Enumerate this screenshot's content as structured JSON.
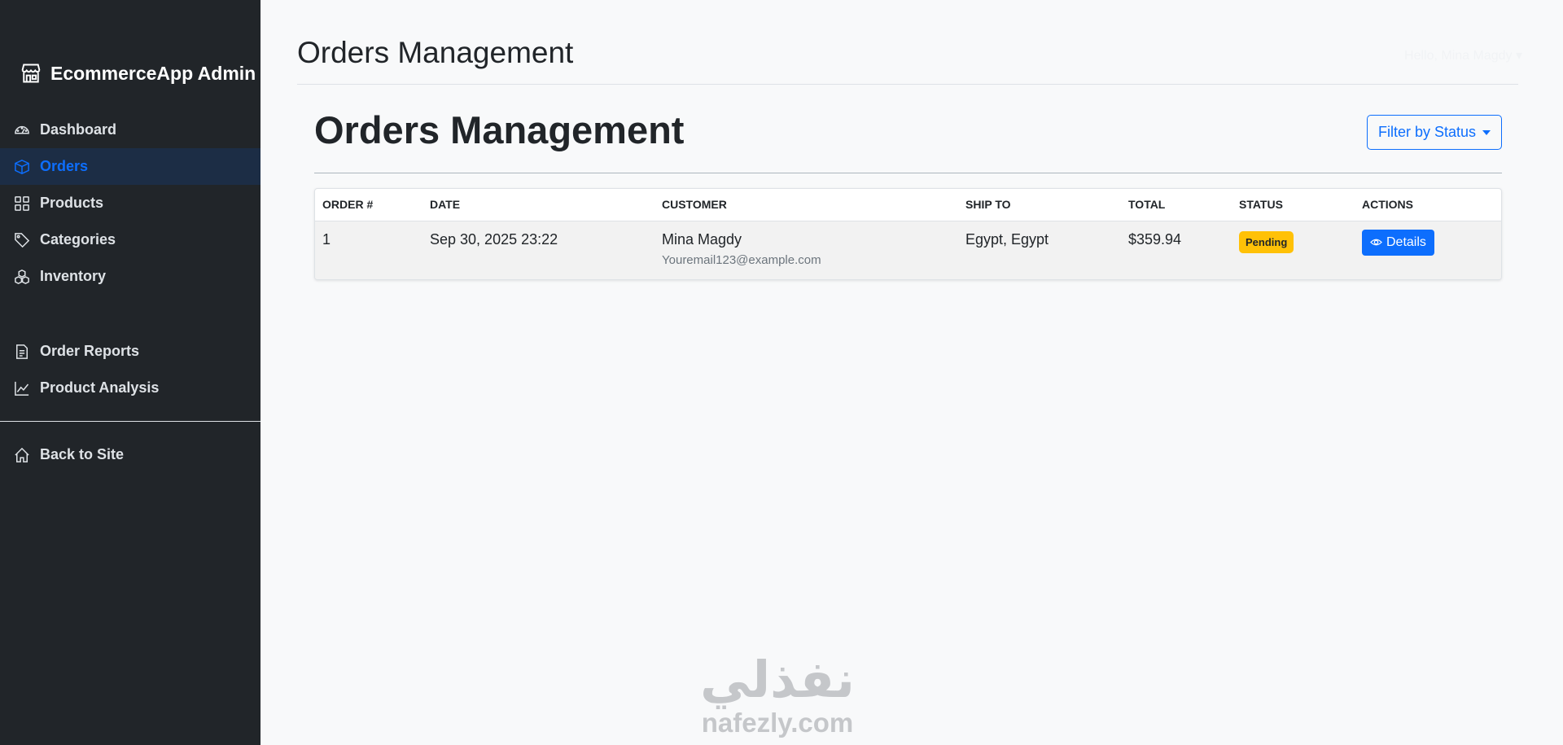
{
  "sidebar": {
    "brand": "EcommerceApp Admin",
    "items": [
      {
        "label": "Dashboard",
        "icon": "speedometer-icon",
        "active": false
      },
      {
        "label": "Orders",
        "icon": "box-icon",
        "active": true
      },
      {
        "label": "Products",
        "icon": "grid-icon",
        "active": false
      },
      {
        "label": "Categories",
        "icon": "tag-icon",
        "active": false
      },
      {
        "label": "Inventory",
        "icon": "boxes-icon",
        "active": false
      }
    ],
    "reports": [
      {
        "label": "Order Reports",
        "icon": "file-text-icon"
      },
      {
        "label": "Product Analysis",
        "icon": "graph-up-icon"
      }
    ],
    "back_to_site": {
      "label": "Back to Site",
      "icon": "house-icon"
    }
  },
  "header": {
    "title": "Orders Management",
    "user_menu": "Hello, Mina Magdy ▾"
  },
  "main": {
    "title": "Orders Management",
    "filter_label": "Filter by Status",
    "table": {
      "columns": [
        "Order #",
        "Date",
        "Customer",
        "Ship To",
        "Total",
        "Status",
        "Actions"
      ],
      "rows": [
        {
          "order": "1",
          "date": "Sep 30, 2025 23:22",
          "customer_name": "Mina Magdy",
          "customer_email": "Youremail123@example.com",
          "ship_to": "Egypt, Egypt",
          "total": "$359.94",
          "status": "Pending",
          "action_label": "Details"
        }
      ]
    }
  },
  "watermark": {
    "arabic": "نفذلي",
    "latin": "nafezly.com"
  },
  "colors": {
    "sidebar_bg": "#212529",
    "accent": "#0d6efd",
    "pending": "#ffc107",
    "page_bg": "#f8f9fa"
  }
}
